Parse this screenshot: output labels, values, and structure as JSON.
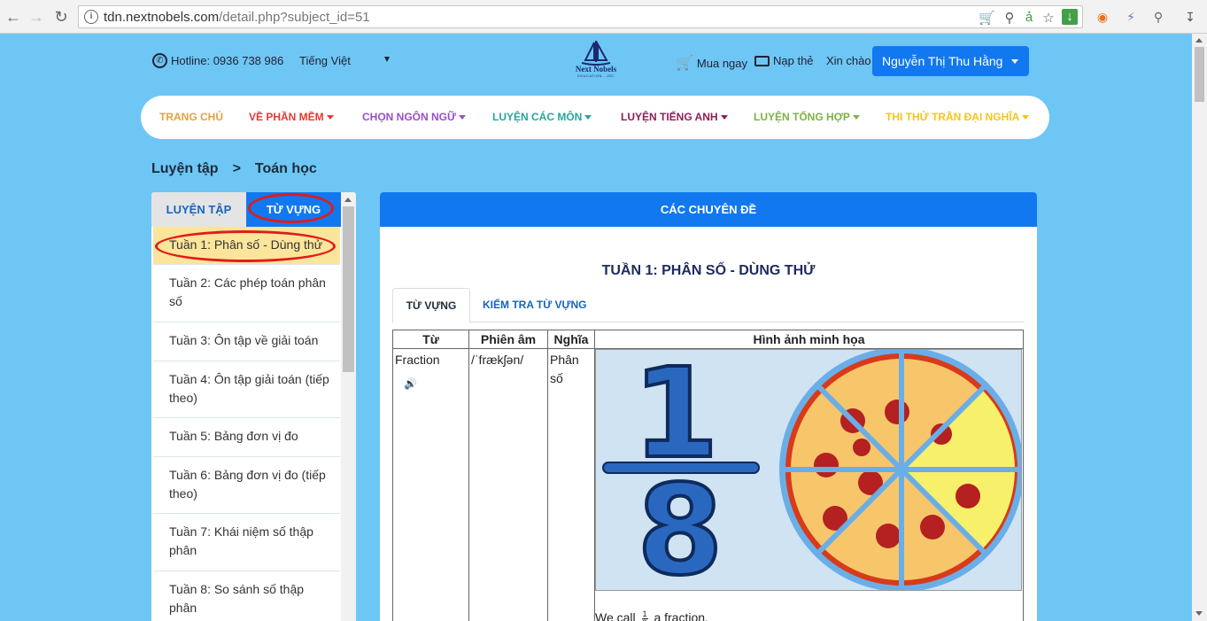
{
  "browser": {
    "url_host": "tdn.nextnobels.com",
    "url_path": "/detail.php?subject_id=51",
    "back_icon": "arrow-left-icon",
    "forward_icon": "arrow-right-icon",
    "reload_icon": "reload-icon",
    "ext_a_text": "ả"
  },
  "topbar": {
    "hotline": "Hotline: 0936 738 986",
    "language": "Tiếng Việt",
    "logo_text": "Next Nobels",
    "logo_sub": "EDUCATION...JSC",
    "buy": "Mua ngay",
    "topup": "Nạp thẻ",
    "greeting": "Xin chào",
    "user": "Nguyễn Thị Thu Hằng"
  },
  "nav": {
    "items": [
      {
        "label": "Trang chủ",
        "color": "#e6a23c"
      },
      {
        "label": "Về phần mềm",
        "color": "#e53935"
      },
      {
        "label": "Chọn ngôn ngữ",
        "color": "#9b4dca"
      },
      {
        "label": "Luyện các môn",
        "color": "#26a69a"
      },
      {
        "label": "Luyện tiếng Anh",
        "color": "#8e1e5b"
      },
      {
        "label": "Luyện tổng hợp",
        "color": "#7cb342"
      },
      {
        "label": "Thi thử Trần Đại Nghĩa",
        "color": "#f5c518"
      }
    ]
  },
  "breadcrumb": {
    "parent": "Luyện tập",
    "separator": ">",
    "current": "Toán học"
  },
  "sidebar": {
    "tab_practice": "LUYỆN TẬP",
    "tab_vocab": "TỪ VỰNG",
    "weeks": [
      "Tuần 1: Phân số - Dùng thử",
      "Tuần 2: Các phép toán phân số",
      "Tuần 3: Ôn tập về giải toán",
      "Tuần 4: Ôn tập giải toán (tiếp theo)",
      "Tuần 5: Bảng đơn vị đo",
      "Tuần 6: Bảng đơn vị đo (tiếp theo)",
      "Tuần 7: Khái niệm số thập phân",
      "Tuần 8: So sánh số thập phân"
    ]
  },
  "content": {
    "header": "Các chuyên đề",
    "lesson_title": "Tuần 1: Phân số - Dùng thử",
    "tab_vocab": "Từ vựng",
    "tab_test": "Kiểm tra từ vựng",
    "table": {
      "headers": [
        "Từ",
        "Phiên âm",
        "Nghĩa",
        "Hình ảnh minh họa"
      ],
      "rows": [
        {
          "word": "Fraction",
          "phonetic": "/ˈfrækʃən/",
          "meaning": "Phân số",
          "icon": "speaker-icon"
        }
      ]
    },
    "illustration": {
      "numerator": "1",
      "denominator": "8"
    },
    "caption_pre": "We call",
    "caption_num": "1",
    "caption_den": "8",
    "caption_post": "a fraction."
  }
}
